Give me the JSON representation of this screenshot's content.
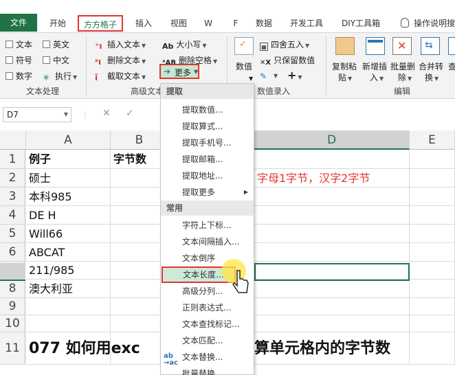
{
  "tabs": [
    {
      "label": "文件"
    },
    {
      "label": "开始"
    },
    {
      "label": "方方格子"
    },
    {
      "label": "插入"
    },
    {
      "label": "视图"
    },
    {
      "label": "W"
    },
    {
      "label": "F"
    },
    {
      "label": "数据"
    },
    {
      "label": "开发工具"
    },
    {
      "label": "DIY工具箱"
    },
    {
      "label": "操作说明搜"
    }
  ],
  "ribbon": {
    "text_process": {
      "checks": [
        "文本",
        "英文",
        "符号",
        "中文",
        "数字",
        "执行"
      ],
      "group_label": "文本处理"
    },
    "advanced_text": {
      "items": [
        "插入文本",
        "删除文本",
        "截取文本",
        "大小写",
        "删除空格",
        "更多"
      ],
      "group_label": "高级文本"
    },
    "numeric_entry": {
      "items": [
        "数值",
        "四舍五入",
        "只保留数值"
      ],
      "group_label": "数值录入"
    },
    "edit": {
      "items": [
        {
          "top": "复制粘",
          "bottom": "贴"
        },
        {
          "top": "新增插",
          "bottom": "入"
        },
        {
          "top": "批量删",
          "bottom": "除"
        },
        {
          "top": "合并转",
          "bottom": "换"
        },
        {
          "top": "查",
          "bottom": ""
        }
      ],
      "group_label": "编辑"
    }
  },
  "formula_bar": {
    "name_box": "D7"
  },
  "columns": [
    "A",
    "B",
    "D",
    "E"
  ],
  "rows": [
    {
      "num": "1",
      "a": "例子",
      "b": "字节数",
      "d": ""
    },
    {
      "num": "2",
      "a": "硕士",
      "b": "",
      "d": "字母1字节，汉字2字节"
    },
    {
      "num": "3",
      "a": "本科985",
      "b": "",
      "d": ""
    },
    {
      "num": "4",
      "a": "DE H",
      "b": "",
      "d": ""
    },
    {
      "num": "5",
      "a": "Will66",
      "b": "",
      "d": ""
    },
    {
      "num": "6",
      "a": "ABCAT",
      "b": "",
      "d": ""
    },
    {
      "num": "7",
      "a": "211/985",
      "b": "",
      "d": ""
    },
    {
      "num": "8",
      "a": "澳大利亚",
      "b": "",
      "d": ""
    },
    {
      "num": "9",
      "a": "",
      "b": "",
      "d": ""
    },
    {
      "num": "10",
      "a": "",
      "b": "",
      "d": ""
    },
    {
      "num": "11",
      "a": "077 如何用exc",
      "b": "",
      "d": "算单元格内的字节数"
    }
  ],
  "menu": {
    "section_extract": "提取",
    "extract_items": [
      "提取数值...",
      "提取算式...",
      "提取手机号...",
      "提取邮箱...",
      "提取地址...",
      "提取更多"
    ],
    "section_common": "常用",
    "common_items": [
      "字符上下标...",
      "文本间隔插入...",
      "文本倒序",
      "文本长度...",
      "高级分列...",
      "正则表达式...",
      "文本查找标记...",
      "文本匹配...",
      "文本替换...",
      "批量替换"
    ]
  },
  "colors": {
    "excel_green": "#217346",
    "highlight_red": "#e03434"
  }
}
